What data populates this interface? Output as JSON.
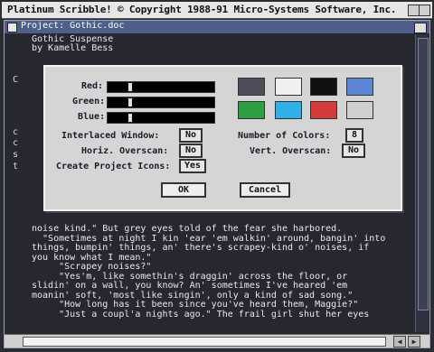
{
  "screen_title": "Platinum Scribble! © Copyright 1988-91 Micro-Systems Software, Inc.",
  "window": {
    "title": "Project: Gothic.doc",
    "heading_lines": [
      "Gothic Suspense",
      "by Kamelle Bess"
    ],
    "side_letters": [
      "C",
      "c",
      "c",
      "s",
      "t"
    ],
    "body_lines": [
      "noise kind.\" But grey eyes told of the fear she harbored.",
      "  \"Sometimes at night I kin 'ear 'em walkin' around, bangin' into",
      "things, bumpin' things, an' there's scrapey-kind o' noises, if",
      "you know what I mean.\"",
      "     \"Scrapey noises?\"",
      "     \"Yes'm, like somethin's draggin' across the floor, or",
      "slidin' on a wall, you know? An' sometimes I've heared 'em",
      "moanin' soft, 'most like singin', only a kind of sad song.\"",
      "     \"How long has it been since you've heard them, Maggie?\"",
      "     \"Just a coupl'a nights ago.\" The frail girl shut her eyes"
    ]
  },
  "dialog": {
    "red_label": "Red:",
    "green_label": "Green:",
    "blue_label": "Blue:",
    "red_value": 0.2,
    "green_value": 0.2,
    "blue_value": 0.2,
    "palette": [
      "#4d4d5a",
      "#f0f0f0",
      "#111111",
      "#5b86d6",
      "#2ea043",
      "#2fb0e8",
      "#d63b3b",
      "#d0d0d0"
    ],
    "interlaced_label": "Interlaced Window:",
    "interlaced_value": "No",
    "horiz_label": "Horiz. Overscan:",
    "horiz_value": "No",
    "icons_label": "Create Project Icons:",
    "icons_value": "Yes",
    "colors_label": "Number of Colors:",
    "colors_value": "8",
    "vert_label": "Vert. Overscan:",
    "vert_value": "No",
    "ok_label": "OK",
    "cancel_label": "Cancel"
  }
}
